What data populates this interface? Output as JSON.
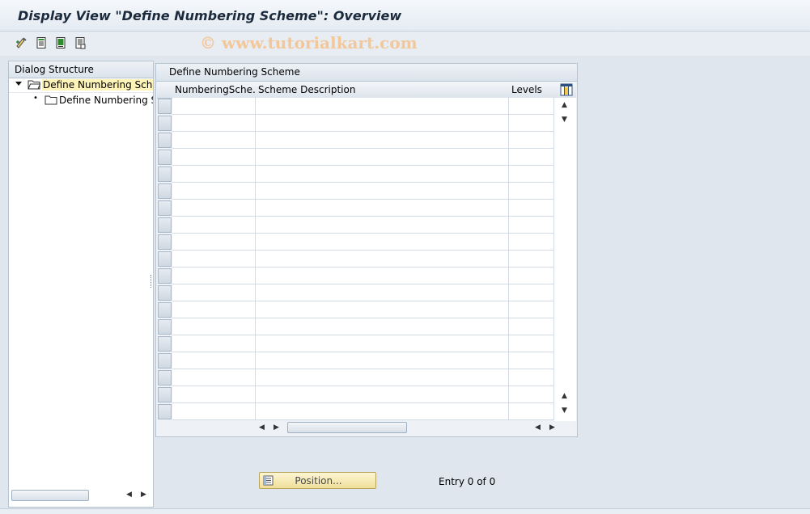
{
  "window": {
    "title": "Display View \"Define Numbering Scheme\": Overview"
  },
  "watermark": "© www.tutorialkart.com",
  "toolbar": {
    "buttons": [
      {
        "icon": "display-change-icon"
      },
      {
        "icon": "details-icon"
      },
      {
        "icon": "select-all-icon"
      },
      {
        "icon": "deselect-icon"
      }
    ]
  },
  "dialog_structure": {
    "header": "Dialog Structure",
    "items": [
      {
        "label": "Define Numbering Scher",
        "level": 0,
        "expanded": true,
        "selected": true
      },
      {
        "label": "Define Numbering Sc",
        "level": 1,
        "expanded": false,
        "selected": false
      }
    ]
  },
  "table": {
    "caption": "Define Numbering Scheme",
    "columns": [
      "NumberingSche...",
      "Scheme Description",
      "Levels"
    ],
    "rows": [
      [
        "",
        "",
        ""
      ],
      [
        "",
        "",
        ""
      ],
      [
        "",
        "",
        ""
      ],
      [
        "",
        "",
        ""
      ],
      [
        "",
        "",
        ""
      ],
      [
        "",
        "",
        ""
      ],
      [
        "",
        "",
        ""
      ],
      [
        "",
        "",
        ""
      ],
      [
        "",
        "",
        ""
      ],
      [
        "",
        "",
        ""
      ],
      [
        "",
        "",
        ""
      ],
      [
        "",
        "",
        ""
      ],
      [
        "",
        "",
        ""
      ],
      [
        "",
        "",
        ""
      ],
      [
        "",
        "",
        ""
      ],
      [
        "",
        "",
        ""
      ],
      [
        "",
        "",
        ""
      ],
      [
        "",
        "",
        ""
      ],
      [
        "",
        "",
        ""
      ]
    ]
  },
  "footer": {
    "position_button": "Position...",
    "entry_text": "Entry 0 of 0"
  },
  "colors": {
    "background": "#dfe6ee",
    "selected_tree_item": "#fff4b8",
    "position_button": "#f5e8b0"
  }
}
